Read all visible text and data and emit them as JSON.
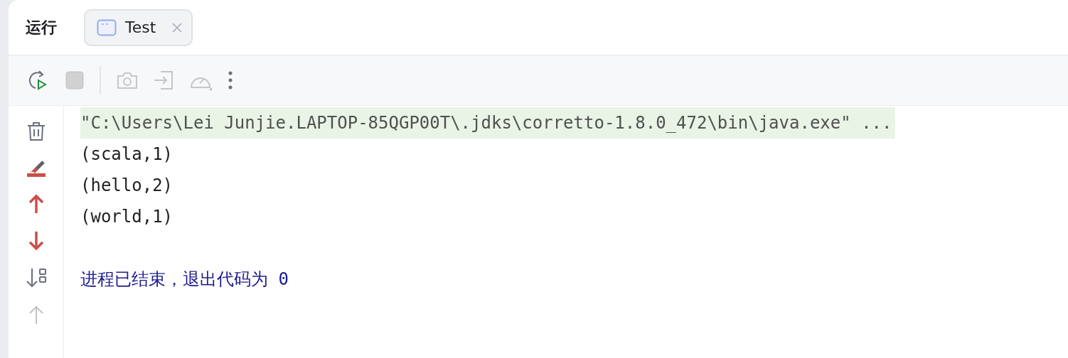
{
  "panel": {
    "title": "运行"
  },
  "tabs": [
    {
      "label": "Test",
      "selected": true
    }
  ],
  "toolbar": [
    {
      "kind": "rerun",
      "disabled": false
    },
    {
      "kind": "stop",
      "disabled": true
    },
    {
      "kind": "separator"
    },
    {
      "kind": "camera",
      "disabled": true
    },
    {
      "kind": "attach",
      "disabled": true
    },
    {
      "kind": "profiler",
      "disabled": true
    },
    {
      "kind": "more",
      "disabled": false
    }
  ],
  "gutter": [
    {
      "kind": "trash",
      "disabled": false
    },
    {
      "kind": "wrap",
      "disabled": false
    },
    {
      "kind": "up",
      "disabled": false
    },
    {
      "kind": "down",
      "disabled": false
    },
    {
      "kind": "scroll-end",
      "disabled": false
    },
    {
      "kind": "top",
      "disabled": true
    }
  ],
  "console": [
    {
      "kind": "command",
      "text": "\"C:\\Users\\Lei Junjie.LAPTOP-85QGP00T\\.jdks\\corretto-1.8.0_472\\bin\\java.exe\" ..."
    },
    {
      "kind": "output",
      "text": "(scala,1)"
    },
    {
      "kind": "output",
      "text": "(hello,2)"
    },
    {
      "kind": "output",
      "text": "(world,1)"
    },
    {
      "kind": "blank"
    },
    {
      "kind": "exit",
      "text": "进程已结束，退出代码为 0"
    }
  ]
}
